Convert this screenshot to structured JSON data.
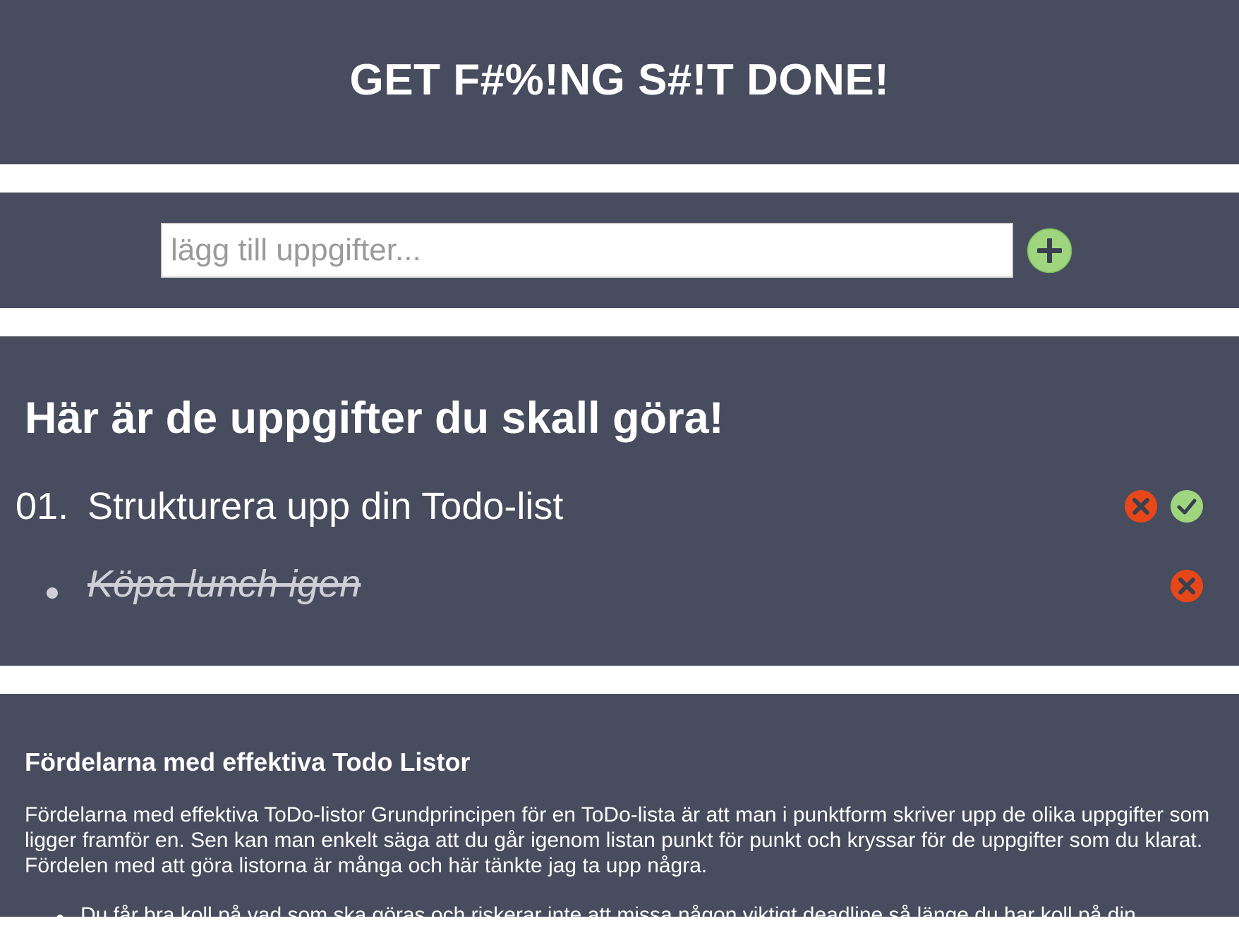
{
  "header": {
    "title": "GET F#%!NG S#!T DONE!"
  },
  "add_task": {
    "placeholder": "lägg till uppgifter...",
    "value": "",
    "add_icon": "plus-circle-icon"
  },
  "tasks": {
    "heading": "Här är de uppgifter du skall göra!",
    "items": [
      {
        "number": "01.",
        "text": "Strukturera upp din Todo-list",
        "completed": false,
        "actions": [
          "delete-icon",
          "check-icon"
        ]
      },
      {
        "text": "Köpa lunch igen",
        "completed": true,
        "actions": [
          "delete-icon"
        ]
      }
    ]
  },
  "info": {
    "heading": "Fördelarna med effektiva Todo Listor",
    "paragraph": "Fördelarna med effektiva ToDo-listor Grundprincipen för en ToDo-lista är att man i punktform skriver upp de olika uppgifter som ligger framför en. Sen kan man enkelt säga att du går igenom listan punkt för punkt och kryssar för de uppgifter som du klarat. Fördelen med att göra listorna är många och här tänkte jag ta upp några.",
    "list": [
      "Du får bra koll på vad som ska göras och riskerar inte att missa någon viktigt deadline så länge du har koll på din"
    ]
  },
  "colors": {
    "band_background": "#474c5e",
    "page_background": "#ffffff",
    "add_green": "#9ed57e",
    "check_green": "#9ed57e",
    "delete_red": "#e8471a",
    "icon_dark": "#3a3f4f"
  }
}
